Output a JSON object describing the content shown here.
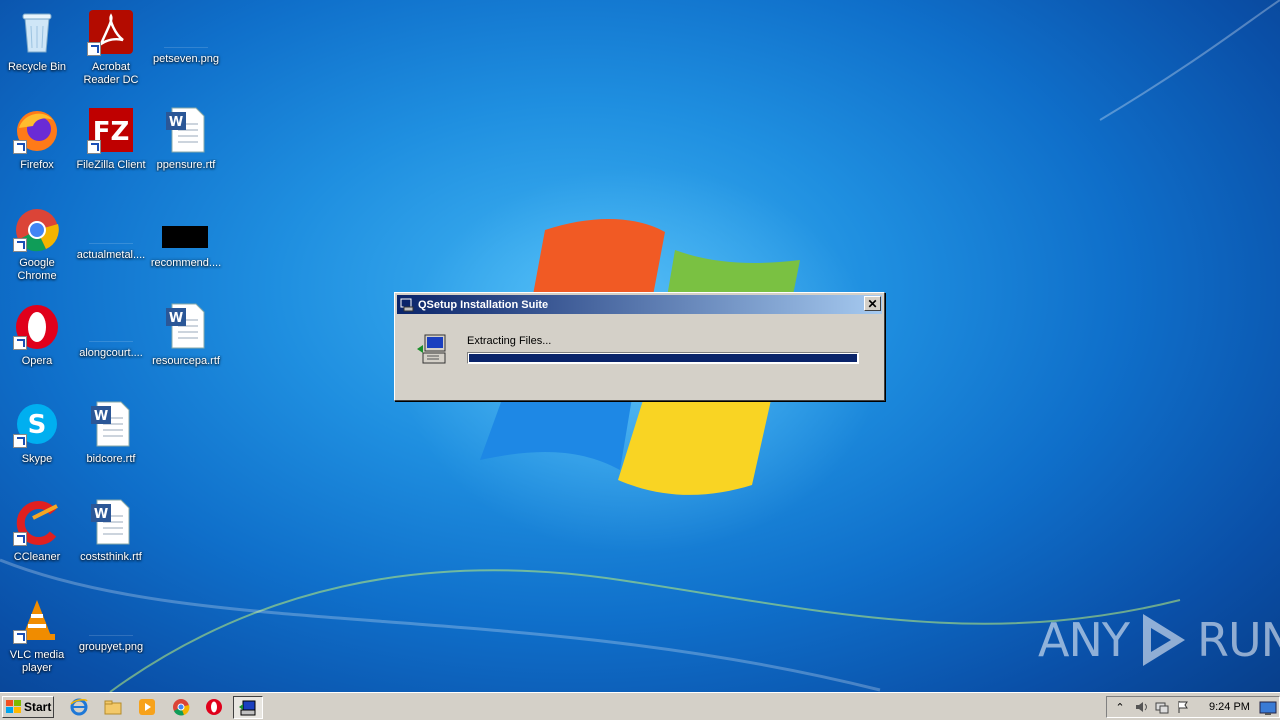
{
  "desktop": {
    "icons": [
      {
        "label": "Recycle Bin"
      },
      {
        "label": "Acrobat Reader DC"
      },
      {
        "label": "petseven.png"
      },
      {
        "label": "Firefox"
      },
      {
        "label": "FileZilla Client"
      },
      {
        "label": "ppensure.rtf"
      },
      {
        "label": "Google Chrome"
      },
      {
        "label": "actualmetal...."
      },
      {
        "label": "recommend...."
      },
      {
        "label": "Opera"
      },
      {
        "label": "alongcourt...."
      },
      {
        "label": "resourcepa.rtf"
      },
      {
        "label": "Skype"
      },
      {
        "label": "bidcore.rtf"
      },
      {
        "label": "CCleaner"
      },
      {
        "label": "coststhink.rtf"
      },
      {
        "label": "VLC media player"
      },
      {
        "label": "groupyet.png"
      }
    ]
  },
  "dialog": {
    "title": "QSetup Installation Suite",
    "close_label": "✕",
    "status_text": "Extracting Files...",
    "progress": 1.0
  },
  "watermark": {
    "left": "ANY",
    "right": "RUN"
  },
  "taskbar": {
    "start_label": "Start",
    "quick_launch": [
      "ie-icon",
      "explorer-icon",
      "media-player-icon",
      "chrome-icon",
      "opera-icon"
    ],
    "active_task_icon": "qsetup-icon",
    "clock": "9:24 PM"
  }
}
